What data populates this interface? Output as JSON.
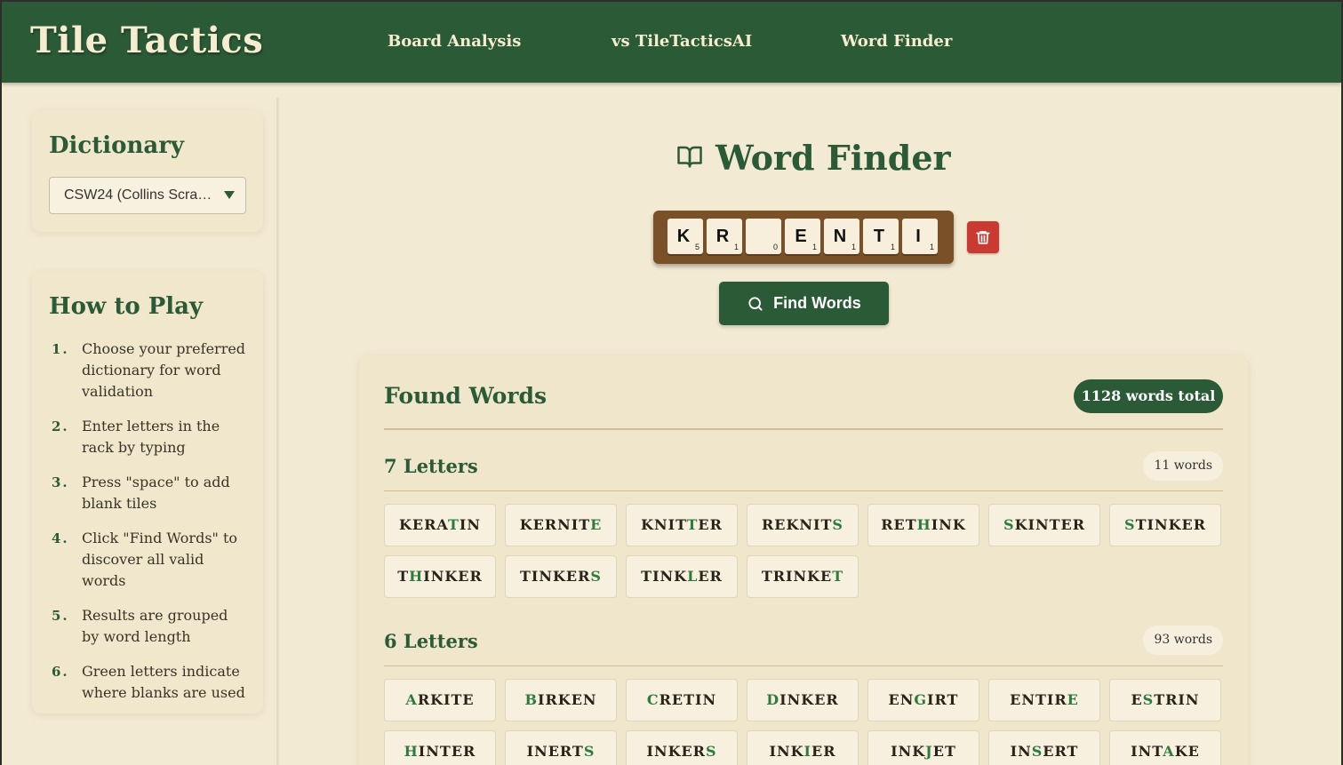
{
  "app": {
    "brand": "Tile Tactics",
    "nav": [
      "Board Analysis",
      "vs TileTacticsAI",
      "Word Finder"
    ]
  },
  "sidebar": {
    "dictionary": {
      "title": "Dictionary",
      "selected": "CSW24 (Collins Scra…"
    },
    "how_to_play": {
      "title": "How to Play",
      "steps": [
        "Choose your preferred dictionary for word validation",
        "Enter letters in the rack by typing",
        "Press \"space\" to add blank tiles",
        "Click \"Find Words\" to discover all valid words",
        "Results are grouped by word length",
        "Green letters indicate where blanks are used"
      ]
    }
  },
  "main": {
    "title": "Word Finder",
    "rack": [
      {
        "letter": "K",
        "points": "5"
      },
      {
        "letter": "R",
        "points": "1"
      },
      {
        "letter": "",
        "points": "0"
      },
      {
        "letter": "E",
        "points": "1"
      },
      {
        "letter": "N",
        "points": "1"
      },
      {
        "letter": "T",
        "points": "1"
      },
      {
        "letter": "I",
        "points": "1"
      }
    ],
    "find_button": "Find Words",
    "results": {
      "title": "Found Words",
      "total": "1128 words total",
      "groups": [
        {
          "title": "7 Letters",
          "count": "11 words",
          "words": [
            {
              "word": "KERATIN",
              "blank_index": 4
            },
            {
              "word": "KERNITE",
              "blank_index": 6
            },
            {
              "word": "KNITTER",
              "blank_index": 4
            },
            {
              "word": "REKNITS",
              "blank_index": 6
            },
            {
              "word": "RETHINK",
              "blank_index": 3
            },
            {
              "word": "SKINTER",
              "blank_index": 0
            },
            {
              "word": "STINKER",
              "blank_index": 0
            },
            {
              "word": "THINKER",
              "blank_index": 1
            },
            {
              "word": "TINKERS",
              "blank_index": 6
            },
            {
              "word": "TINKLER",
              "blank_index": 4
            },
            {
              "word": "TRINKET",
              "blank_index": 6
            }
          ]
        },
        {
          "title": "6 Letters",
          "count": "93 words",
          "words": [
            {
              "word": "ARKITE",
              "blank_index": 0
            },
            {
              "word": "BIRKEN",
              "blank_index": 0
            },
            {
              "word": "CRETIN",
              "blank_index": 0
            },
            {
              "word": "DINKER",
              "blank_index": 0
            },
            {
              "word": "ENGIRT",
              "blank_index": 2
            },
            {
              "word": "ENTIRE",
              "blank_index": 5
            },
            {
              "word": "ESTRIN",
              "blank_index": 1
            },
            {
              "word": "HINTER",
              "blank_index": 0
            },
            {
              "word": "INERTS",
              "blank_index": 5
            },
            {
              "word": "INKERS",
              "blank_index": 5
            },
            {
              "word": "INKIER",
              "blank_index": 3
            },
            {
              "word": "INKJET",
              "blank_index": 3
            },
            {
              "word": "INSERT",
              "blank_index": 2
            },
            {
              "word": "INTAKE",
              "blank_index": 3
            }
          ]
        }
      ]
    }
  },
  "colors": {
    "primary": "#2a5a36",
    "background": "#f3ead3",
    "rack": "#7a5028",
    "danger": "#c93a33",
    "blank_letter": "#2f7a3e"
  },
  "icons": {
    "title": "book-open-icon",
    "trash": "trash-icon",
    "find": "search-icon",
    "select": "chevron-down-icon"
  }
}
